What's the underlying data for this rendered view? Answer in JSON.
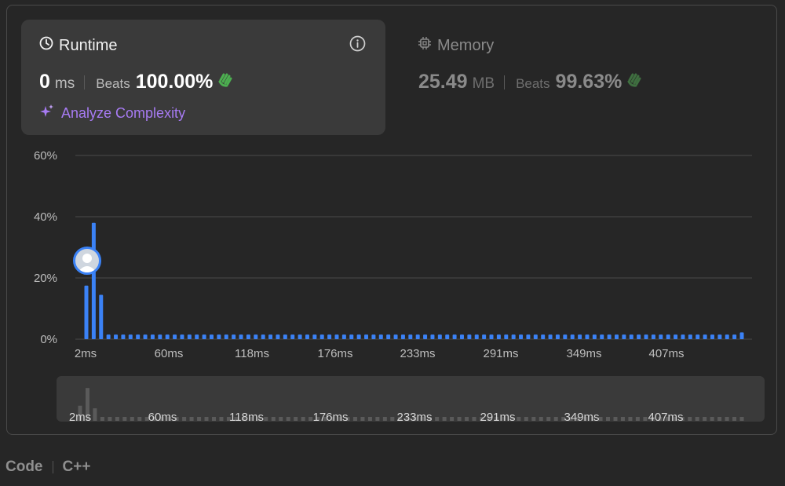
{
  "runtime": {
    "title": "Runtime",
    "value": "0",
    "unit": "ms",
    "beats_label": "Beats",
    "beats_pct": "100.00%",
    "analyze_label": "Analyze Complexity"
  },
  "memory": {
    "title": "Memory",
    "value": "25.49",
    "unit": "MB",
    "beats_label": "Beats",
    "beats_pct": "99.63%"
  },
  "footer": {
    "code_label": "Code",
    "language": "C++"
  },
  "chart_data": {
    "type": "bar",
    "ylabel_ticks": [
      "0%",
      "20%",
      "40%",
      "60%"
    ],
    "ylim": [
      0,
      60
    ],
    "x_tick_labels": [
      "2ms",
      "60ms",
      "118ms",
      "176ms",
      "233ms",
      "291ms",
      "349ms",
      "407ms"
    ],
    "values": [
      17.5,
      38,
      14.5,
      1.5,
      1.5,
      1.5,
      1.5,
      1.5,
      1.5,
      1.5,
      1.5,
      1.5,
      1.5,
      1.5,
      1.5,
      1.5,
      1.5,
      1.5,
      1.5,
      1.5,
      1.5,
      1.5,
      1.5,
      1.5,
      1.5,
      1.5,
      1.5,
      1.5,
      1.5,
      1.5,
      1.5,
      1.5,
      1.5,
      1.5,
      1.5,
      1.5,
      1.5,
      1.5,
      1.5,
      1.5,
      1.5,
      1.5,
      1.5,
      1.5,
      1.5,
      1.5,
      1.5,
      1.5,
      1.5,
      1.5,
      1.5,
      1.5,
      1.5,
      1.5,
      1.5,
      1.5,
      1.5,
      1.5,
      1.5,
      1.5,
      1.5,
      1.5,
      1.5,
      1.5,
      1.5,
      1.5,
      1.5,
      1.5,
      1.5,
      1.5,
      1.5,
      1.5,
      1.5,
      1.5,
      1.5,
      1.5,
      1.5,
      1.5,
      1.5,
      1.5,
      1.5,
      1.5,
      1.5,
      1.5,
      1.5,
      1.5,
      1.5,
      1.5,
      1.5,
      2.2
    ],
    "highlight_index": 0,
    "grid": true,
    "bar_color": "#3b82f6"
  },
  "colors": {
    "accent": "#3b82f6",
    "purple": "#a77bf3",
    "green": "#4caf50"
  }
}
